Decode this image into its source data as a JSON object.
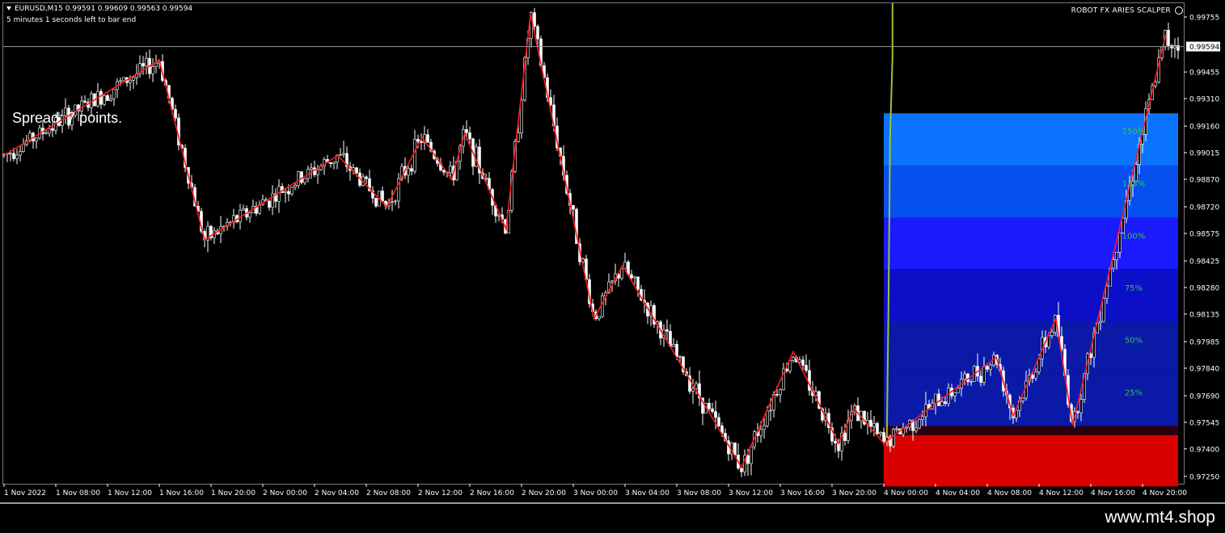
{
  "header": {
    "symbol_line": "EURUSD,M15  0.99591 0.99609 0.99563 0.99594",
    "timer_text": "5 minutes 1 seconds left to bar end",
    "robot_label": "ROBOT FX ARIES SCALPER"
  },
  "spread_text": "Spread: 7 points.",
  "footer": {
    "url": "www.mt4.shop"
  },
  "colors": {
    "background": "#000000",
    "candles": "#ffffff",
    "zigzag": "#ff1a1a",
    "zone_red": "#d90000",
    "zone_blue_light": "#0a73ff",
    "zone_blue_mid": "#0550ef",
    "zone_blue_violet": "#1a1aff",
    "zone_blue_dark": "#0b10c8",
    "zone_blue_deep": "#0a1aa6",
    "level_labels": "#33c24a",
    "vertical_marker": "#a0c030"
  },
  "chart_data": {
    "type": "candlestick",
    "symbol": "EURUSD",
    "timeframe": "M15",
    "current_price": "0.99594",
    "ohlc_last": {
      "open": 0.99591,
      "high": 0.99609,
      "low": 0.99563,
      "close": 0.99594
    },
    "price_ticks": [
      "0.99755",
      "0.99594",
      "0.99455",
      "0.99310",
      "0.99160",
      "0.99015",
      "0.98870",
      "0.98720",
      "0.98575",
      "0.98425",
      "0.98280",
      "0.98135",
      "0.97985",
      "0.97840",
      "0.97690",
      "0.97545",
      "0.97400",
      "0.97250"
    ],
    "ylim": [
      0.9721,
      0.9983
    ],
    "time_ticks": [
      "1 Nov 2022",
      "1 Nov 08:00",
      "1 Nov 12:00",
      "1 Nov 16:00",
      "1 Nov 20:00",
      "2 Nov 00:00",
      "2 Nov 04:00",
      "2 Nov 08:00",
      "2 Nov 12:00",
      "2 Nov 16:00",
      "2 Nov 20:00",
      "3 Nov 00:00",
      "3 Nov 04:00",
      "3 Nov 08:00",
      "3 Nov 12:00",
      "3 Nov 16:00",
      "3 Nov 20:00",
      "4 Nov 00:00",
      "4 Nov 04:00",
      "4 Nov 08:00",
      "4 Nov 12:00",
      "4 Nov 16:00",
      "4 Nov 20:00"
    ],
    "zigzag": [
      {
        "t": 0.0,
        "p": 0.99
      },
      {
        "t": 12.0,
        "p": 0.9952
      },
      {
        "t": 15.5,
        "p": 0.9854
      },
      {
        "t": 25.8,
        "p": 0.99
      },
      {
        "t": 29.6,
        "p": 0.9872
      },
      {
        "t": 32.3,
        "p": 0.991
      },
      {
        "t": 34.6,
        "p": 0.9887
      },
      {
        "t": 35.6,
        "p": 0.9912
      },
      {
        "t": 38.8,
        "p": 0.986
      },
      {
        "t": 40.7,
        "p": 0.9977
      },
      {
        "t": 45.6,
        "p": 0.9811
      },
      {
        "t": 47.8,
        "p": 0.984
      },
      {
        "t": 57.0,
        "p": 0.973
      },
      {
        "t": 61.0,
        "p": 0.9793
      },
      {
        "t": 64.5,
        "p": 0.9743
      },
      {
        "t": 65.7,
        "p": 0.9762
      },
      {
        "t": 68.0,
        "p": 0.9743
      },
      {
        "t": 76.7,
        "p": 0.979
      },
      {
        "t": 78.0,
        "p": 0.9758
      },
      {
        "t": 81.3,
        "p": 0.9811
      },
      {
        "t": 82.6,
        "p": 0.9753
      },
      {
        "t": 89.8,
        "p": 0.9966
      }
    ],
    "zones": [
      {
        "name": "red-zone",
        "from": 0.97195,
        "to": 0.97475,
        "color": "#d90000"
      },
      {
        "name": "level-0",
        "from": 0.97525,
        "to": 0.9781,
        "color": "#0a1aa6"
      },
      {
        "name": "level-25",
        "from": 0.9781,
        "to": 0.98095,
        "color": "#0a1aa6"
      },
      {
        "name": "level-50",
        "from": 0.98095,
        "to": 0.9838,
        "color": "#0b10c8"
      },
      {
        "name": "level-75",
        "from": 0.9838,
        "to": 0.9866,
        "color": "#1a1aff"
      },
      {
        "name": "level-100",
        "from": 0.9866,
        "to": 0.98945,
        "color": "#0550ef"
      },
      {
        "name": "level-125",
        "from": 0.98945,
        "to": 0.9923,
        "color": "#0a73ff"
      }
    ],
    "level_labels": [
      {
        "label": "25%",
        "price": 0.9771
      },
      {
        "label": "50%",
        "price": 0.97995
      },
      {
        "label": "75%",
        "price": 0.9828
      },
      {
        "label": "100%",
        "price": 0.98565
      },
      {
        "label": "125%",
        "price": 0.9885
      },
      {
        "label": "150%",
        "price": 0.99135
      }
    ],
    "grid": false,
    "legend": "none"
  }
}
